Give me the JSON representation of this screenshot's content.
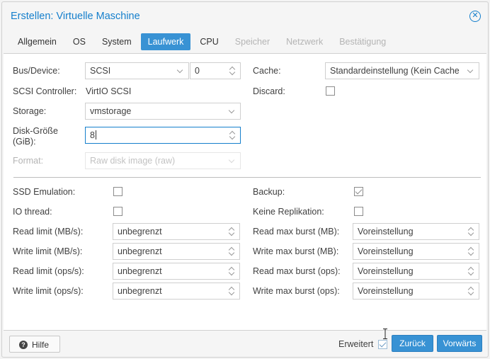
{
  "title": "Erstellen: Virtuelle Maschine",
  "tabs": [
    {
      "label": "Allgemein",
      "state": "normal"
    },
    {
      "label": "OS",
      "state": "normal"
    },
    {
      "label": "System",
      "state": "normal"
    },
    {
      "label": "Laufwerk",
      "state": "active"
    },
    {
      "label": "CPU",
      "state": "normal"
    },
    {
      "label": "Speicher",
      "state": "disabled"
    },
    {
      "label": "Netzwerk",
      "state": "disabled"
    },
    {
      "label": "Bestätigung",
      "state": "disabled"
    }
  ],
  "disk": {
    "bus_label": "Bus/Device:",
    "bus_value": "SCSI",
    "device_value": "0",
    "controller_label": "SCSI Controller:",
    "controller_value": "VirtIO SCSI",
    "storage_label": "Storage:",
    "storage_value": "vmstorage",
    "size_label_line1": "Disk-Größe",
    "size_label_line2": "(GiB):",
    "size_value": "8",
    "format_label": "Format:",
    "format_value": "Raw disk image (raw)",
    "cache_label": "Cache:",
    "cache_value": "Standardeinstellung (Kein Cache",
    "discard_label": "Discard:",
    "discard_checked": false
  },
  "advanced": {
    "ssd_label": "SSD Emulation:",
    "ssd_checked": false,
    "iothread_label": "IO thread:",
    "iothread_checked": false,
    "backup_label": "Backup:",
    "backup_checked": true,
    "noreplication_label": "Keine Replikation:",
    "noreplication_checked": false,
    "read_mb_label": "Read limit (MB/s):",
    "read_mb_value": "unbegrenzt",
    "write_mb_label": "Write limit (MB/s):",
    "write_mb_value": "unbegrenzt",
    "read_ops_label": "Read limit (ops/s):",
    "read_ops_value": "unbegrenzt",
    "write_ops_label": "Write limit (ops/s):",
    "write_ops_value": "unbegrenzt",
    "read_burst_mb_label": "Read max burst (MB):",
    "read_burst_mb_value": "Voreinstellung",
    "write_burst_mb_label": "Write max burst (MB):",
    "write_burst_mb_value": "Voreinstellung",
    "read_burst_ops_label": "Read max burst (ops):",
    "read_burst_ops_value": "Voreinstellung",
    "write_burst_ops_label": "Write max burst (ops):",
    "write_burst_ops_value": "Voreinstellung"
  },
  "footer": {
    "help_label": "Hilfe",
    "advanced_label": "Erweitert",
    "advanced_checked": true,
    "back_label": "Zurück",
    "next_label": "Vorwärts"
  },
  "colors": {
    "accent": "#157fcc",
    "active_tab": "#3892d4",
    "disabled_text": "#b4b4b4"
  }
}
